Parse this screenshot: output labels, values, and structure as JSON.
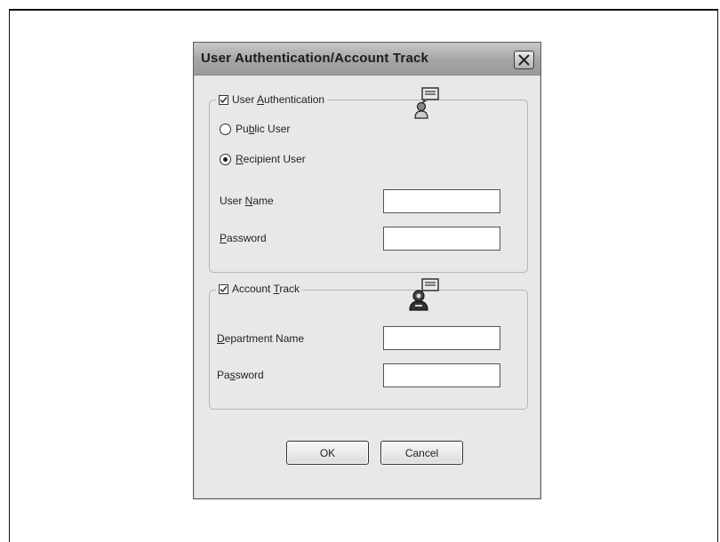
{
  "dialog": {
    "title": "User Authentication/Account Track",
    "user_auth": {
      "checkbox_label_pre": "User ",
      "checkbox_label_key": "A",
      "checkbox_label_post": "uthentication",
      "checked": true,
      "options": [
        {
          "pre": "Pu",
          "key": "b",
          "post": "lic User",
          "selected": false
        },
        {
          "pre": "",
          "key": "R",
          "post": "ecipient User",
          "selected": true
        }
      ],
      "user_name_label_pre": "User ",
      "user_name_label_key": "N",
      "user_name_label_post": "ame",
      "user_name_value": "",
      "password_label_pre": "",
      "password_label_key": "P",
      "password_label_post": "assword",
      "password_value": ""
    },
    "account_track": {
      "checkbox_label_pre": "Account ",
      "checkbox_label_key": "T",
      "checkbox_label_post": "rack",
      "checked": true,
      "department_label_pre": "",
      "department_label_key": "D",
      "department_label_post": "epartment Name",
      "department_value": "",
      "password_label_pre": "Pa",
      "password_label_key": "s",
      "password_label_post": "sword",
      "password_value": ""
    },
    "ok_label": "OK",
    "cancel_label": "Cancel"
  }
}
